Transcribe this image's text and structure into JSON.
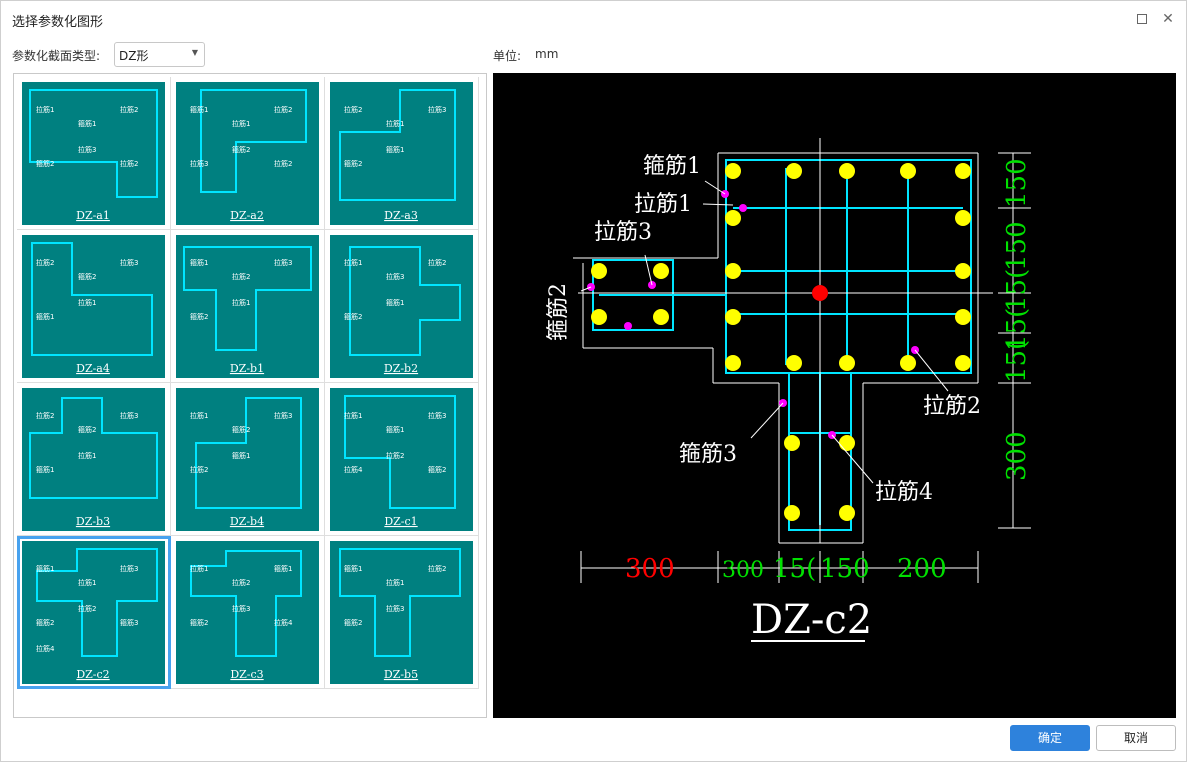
{
  "window": {
    "title": "选择参数化图形",
    "maximize_icon": "maximize-icon",
    "close_icon": "close-icon"
  },
  "section_type": {
    "label": "参数化截面类型:",
    "selected": "DZ形"
  },
  "unit": {
    "label": "单位:",
    "value": "mm"
  },
  "thumbnails": {
    "selected": "DZ-c2",
    "items": [
      {
        "caption": "DZ-a1",
        "labels": [
          "拉筋1",
          "箍筋1",
          "拉筋2",
          "箍筋2",
          "拉筋3",
          "拉筋2"
        ]
      },
      {
        "caption": "DZ-a2",
        "labels": [
          "箍筋1",
          "拉筋1",
          "拉筋2",
          "拉筋3",
          "箍筋2",
          "拉筋2"
        ]
      },
      {
        "caption": "DZ-a3",
        "labels": [
          "拉筋2",
          "拉筋1",
          "拉筋3",
          "箍筋2",
          "箍筋1"
        ]
      },
      {
        "caption": "DZ-a4",
        "labels": [
          "拉筋2",
          "箍筋2",
          "拉筋3",
          "箍筋1",
          "拉筋1"
        ]
      },
      {
        "caption": "DZ-b1",
        "labels": [
          "箍筋1",
          "拉筋2",
          "拉筋3",
          "箍筋2",
          "拉筋1"
        ]
      },
      {
        "caption": "DZ-b2",
        "labels": [
          "拉筋1",
          "拉筋3",
          "拉筋2",
          "箍筋2",
          "箍筋1"
        ]
      },
      {
        "caption": "DZ-b3",
        "labels": [
          "拉筋2",
          "箍筋2",
          "拉筋3",
          "箍筋1",
          "拉筋1"
        ]
      },
      {
        "caption": "DZ-b4",
        "labels": [
          "拉筋1",
          "箍筋2",
          "拉筋3",
          "拉筋2",
          "箍筋1"
        ]
      },
      {
        "caption": "DZ-c1",
        "labels": [
          "拉筋1",
          "箍筋1",
          "拉筋3",
          "拉筋4",
          "拉筋2",
          "箍筋2"
        ]
      },
      {
        "caption": "DZ-c2",
        "labels": [
          "箍筋1",
          "拉筋1",
          "拉筋3",
          "箍筋2",
          "拉筋2",
          "箍筋3",
          "拉筋4"
        ]
      },
      {
        "caption": "DZ-c3",
        "labels": [
          "拉筋1",
          "拉筋2",
          "箍筋1",
          "箍筋2",
          "拉筋3",
          "拉筋4"
        ]
      },
      {
        "caption": "DZ-b5",
        "labels": [
          "箍筋1",
          "拉筋1",
          "拉筋2",
          "箍筋2",
          "拉筋3"
        ]
      }
    ]
  },
  "preview": {
    "title": "DZ-c2",
    "labels": {
      "stirrup1": "箍筋1",
      "tie1": "拉筋1",
      "tie3": "拉筋3",
      "stirrup2": "箍筋2",
      "tie2": "拉筋2",
      "stirrup3": "箍筋3",
      "tie4": "拉筋4"
    },
    "dims_bottom": [
      "300",
      "300",
      "15(",
      "150",
      "200"
    ],
    "dims_right": [
      "150",
      "150",
      "15(",
      "15(",
      "15(",
      "300"
    ],
    "colors": {
      "background": "#000000",
      "rebar": "#00e5ff",
      "bar_dot": "#ffff00",
      "tie_dot": "#ff00ff",
      "center": "#ff0000",
      "dim_red": "#ff0000",
      "dim_green": "#00e000",
      "text": "#ffffff"
    }
  },
  "buttons": {
    "ok": "确定",
    "cancel": "取消"
  }
}
